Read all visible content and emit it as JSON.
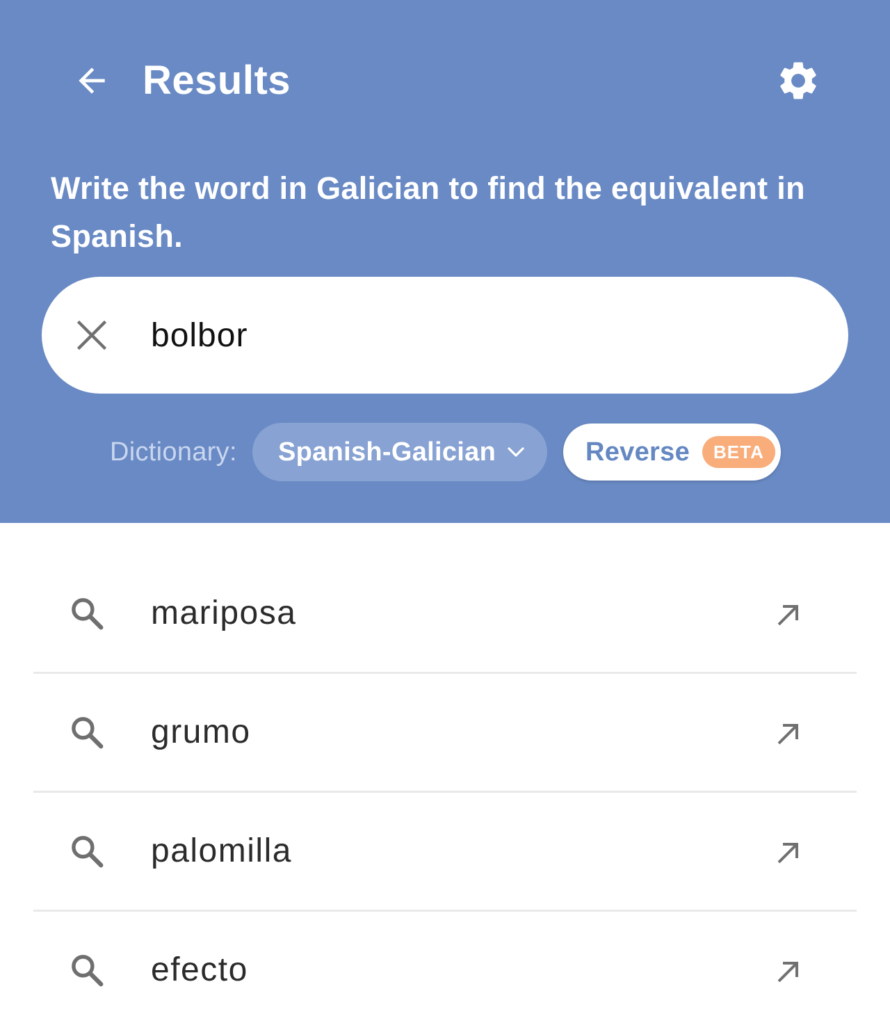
{
  "header": {
    "title": "Results",
    "instructions": "Write the word in Galician to find the equivalent in Spanish."
  },
  "search": {
    "value": "bolbor"
  },
  "dictionary": {
    "label": "Dictionary:",
    "selected": "Spanish-Galician",
    "reverse_label": "Reverse",
    "beta_badge": "BETA"
  },
  "results": [
    "mariposa",
    "grumo",
    "palomilla",
    "efecto"
  ],
  "colors": {
    "header_bg": "#698ac4",
    "select_bg": "#87a2d3",
    "reverse_text": "#6587c2",
    "beta_bg": "#f8ad7b"
  }
}
